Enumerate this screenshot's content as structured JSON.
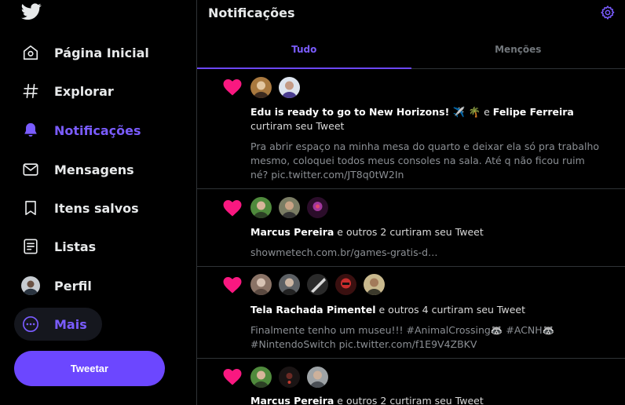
{
  "sidebar": {
    "logo_icon": "twitter-bird-icon",
    "items": [
      {
        "label": "Página Inicial",
        "icon": "home-icon"
      },
      {
        "label": "Explorar",
        "icon": "hashtag-icon"
      },
      {
        "label": "Notificações",
        "icon": "bell-icon",
        "active": true
      },
      {
        "label": "Mensagens",
        "icon": "envelope-icon"
      },
      {
        "label": "Itens salvos",
        "icon": "bookmark-icon"
      },
      {
        "label": "Listas",
        "icon": "list-icon"
      },
      {
        "label": "Perfil",
        "icon": "avatar"
      },
      {
        "label": "Mais",
        "icon": "more-icon"
      }
    ],
    "tweet_button": "Tweetar"
  },
  "header": {
    "title": "Notificações",
    "settings_icon": "gear-icon"
  },
  "tabs": [
    {
      "label": "Tudo",
      "active": true
    },
    {
      "label": "Menções",
      "active": false
    }
  ],
  "notifications": [
    {
      "icon": "heart-icon",
      "avatars": 2,
      "actor1": "Edu is ready to go to New Horizons! ✈️ 🌴",
      "connector": " e ",
      "actor2": "Felipe Ferreira",
      "action": " curtiram seu Tweet",
      "snippet": "Pra abrir espaço na minha mesa do quarto e deixar ela só pra trabalho mesmo, coloquei todos meus consoles na sala. Até q não ficou ruim né? pic.twitter.com/JT8q0tW2In"
    },
    {
      "icon": "heart-icon",
      "avatars": 3,
      "actor1": "Marcus Pereira",
      "action": " e outros 2 curtiram seu Tweet",
      "snippet": "showmetech.com.br/games-gratis-d…"
    },
    {
      "icon": "heart-icon",
      "avatars": 5,
      "actor1": "Tela Rachada Pimentel",
      "action": " e outros 4 curtiram seu Tweet",
      "snippet": "Finalmente tenho um museu!!! #AnimalCrossing🦝 #ACNH🦝 #NintendoSwitch pic.twitter.com/f1E9V4ZBKV"
    },
    {
      "icon": "heart-icon",
      "avatars": 3,
      "actor1": "Marcus Pereira",
      "action": " e outros 2 curtiram seu Tweet"
    }
  ],
  "colors": {
    "accent": "#6c47ff",
    "accent_text": "#7a5cff",
    "like": "#f91880",
    "divider": "#2f3336"
  }
}
